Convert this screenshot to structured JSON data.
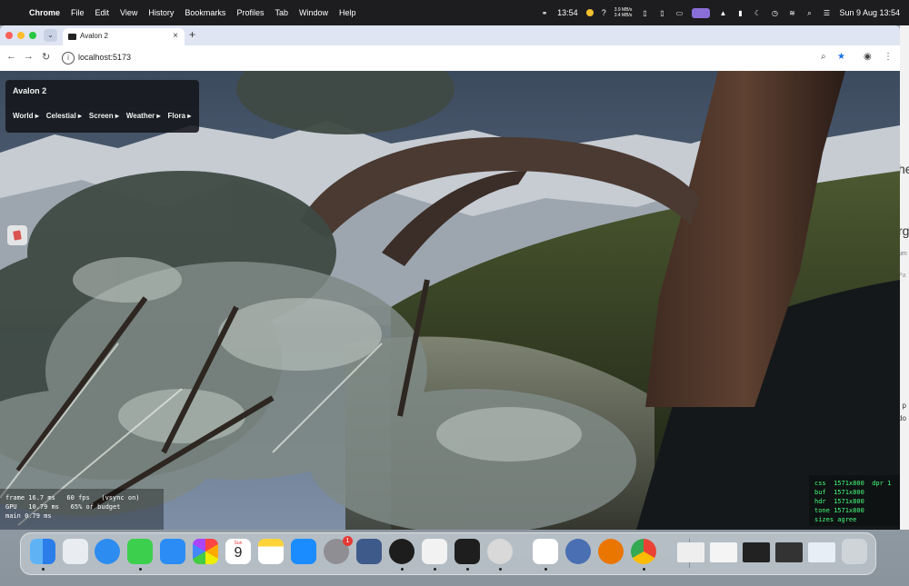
{
  "menubar": {
    "app_name": "Chrome",
    "items": [
      "File",
      "Edit",
      "View",
      "History",
      "Bookmarks",
      "Profiles",
      "Tab",
      "Window",
      "Help"
    ],
    "time_short": "13:54",
    "net_up": "3.9 MB/s",
    "net_down": "3.4 MB/s",
    "question": "?",
    "datetime": "Sun 9 Aug  13:54"
  },
  "browser": {
    "tab_title": "Avalon 2",
    "url": "localhost:5173",
    "new_tab": "+"
  },
  "app": {
    "panel_title": "Avalon 2",
    "menus": [
      "World ▸",
      "Celestial ▸",
      "Screen ▸",
      "Weather ▸",
      "Flora ▸"
    ]
  },
  "stats_left": {
    "line1": "frame 16.7 ms   60 fps   (vsync on)",
    "line2": "GPU   10.79 ms   65% of budget",
    "line3": "main 0.79 ms"
  },
  "stats_right": {
    "line1": "css  1571x800  dpr 1",
    "line2": "buf  1571x800",
    "line3": "hdr  1571x800",
    "line4": "tone 1571x800",
    "line5": "sizes agree"
  },
  "dock": {
    "calendar_month": "Sun",
    "calendar_day": "9",
    "settings_badge": "1"
  },
  "right_strip": {
    "t1": "he",
    "t2": "rg",
    "t3": "um",
    "t4": "Pa",
    "t5": ", p",
    "t6": "do"
  },
  "colors": {
    "menubar": "#1d1d1f",
    "stats_green": "#44ff7a",
    "panel_bg": "#14161a"
  }
}
